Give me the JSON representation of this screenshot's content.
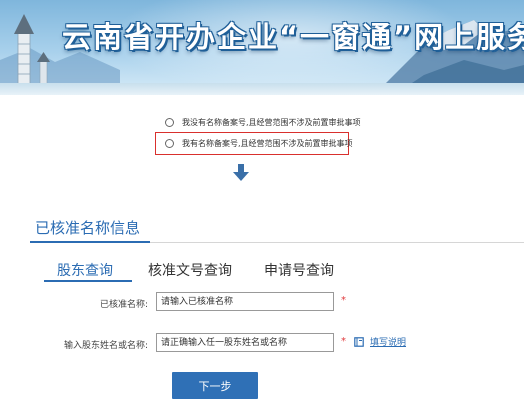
{
  "banner": {
    "title": "云南省开办企业“一窗通”网上服务"
  },
  "options": {
    "option1": "我没有名称备案号,且经营范围不涉及前置审批事项",
    "option2": "我有名称备案号,且经营范围不涉及前置审批事项",
    "selected": null,
    "highlight_color": "#d9302d"
  },
  "arrow_icon": "arrow-down-icon",
  "section": {
    "title": "已核准名称信息"
  },
  "tabs": [
    {
      "label": "股东查询",
      "active": true
    },
    {
      "label": "核准文号查询",
      "active": false
    },
    {
      "label": "申请号查询",
      "active": false
    }
  ],
  "form": {
    "approved_name_label": "已核准名称:",
    "approved_name_placeholder": "请输入已核准名称",
    "shareholder_label": "输入股东姓名或名称:",
    "shareholder_placeholder": "请正确输入任一股东姓名或名称",
    "required_mark": "*",
    "help_text": "填写说明",
    "help_icon": "book-icon"
  },
  "next_button": "下一步",
  "colors": {
    "accent": "#2b6cb3",
    "button": "#2f70b6",
    "required": "#e0393c"
  }
}
